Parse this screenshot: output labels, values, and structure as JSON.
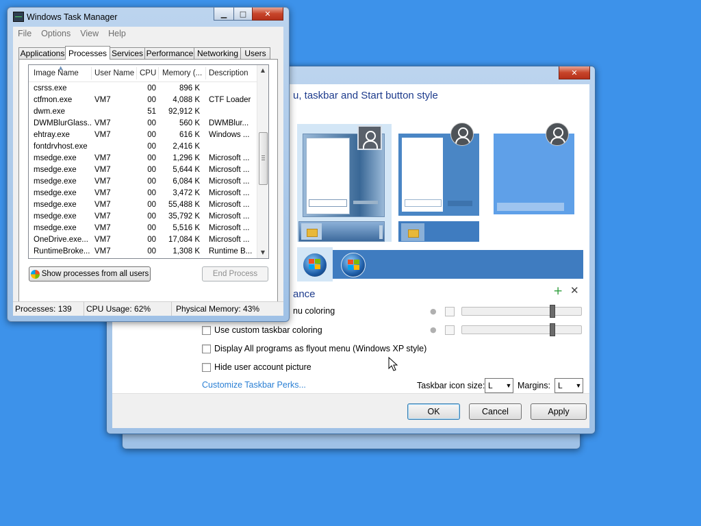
{
  "task_manager": {
    "title": "Windows Task Manager",
    "menu": [
      "File",
      "Options",
      "View",
      "Help"
    ],
    "tabs": [
      "Applications",
      "Processes",
      "Services",
      "Performance",
      "Networking",
      "Users"
    ],
    "active_tab": "Processes",
    "columns": [
      "Image Name",
      "User Name",
      "CPU",
      "Memory (...",
      "Description"
    ],
    "processes": [
      {
        "name": "csrss.exe",
        "user": "",
        "cpu": "00",
        "mem": "896 K",
        "desc": ""
      },
      {
        "name": "ctfmon.exe",
        "user": "VM7",
        "cpu": "00",
        "mem": "4,088 K",
        "desc": "CTF Loader"
      },
      {
        "name": "dwm.exe",
        "user": "",
        "cpu": "51",
        "mem": "92,912 K",
        "desc": ""
      },
      {
        "name": "DWMBlurGlass...",
        "user": "VM7",
        "cpu": "00",
        "mem": "560 K",
        "desc": "DWMBlur..."
      },
      {
        "name": "ehtray.exe",
        "user": "VM7",
        "cpu": "00",
        "mem": "616 K",
        "desc": "Windows ..."
      },
      {
        "name": "fontdrvhost.exe",
        "user": "",
        "cpu": "00",
        "mem": "2,416 K",
        "desc": ""
      },
      {
        "name": "msedge.exe",
        "user": "VM7",
        "cpu": "00",
        "mem": "1,296 K",
        "desc": "Microsoft ..."
      },
      {
        "name": "msedge.exe",
        "user": "VM7",
        "cpu": "00",
        "mem": "5,644 K",
        "desc": "Microsoft ..."
      },
      {
        "name": "msedge.exe",
        "user": "VM7",
        "cpu": "00",
        "mem": "6,084 K",
        "desc": "Microsoft ..."
      },
      {
        "name": "msedge.exe",
        "user": "VM7",
        "cpu": "00",
        "mem": "3,472 K",
        "desc": "Microsoft ..."
      },
      {
        "name": "msedge.exe",
        "user": "VM7",
        "cpu": "00",
        "mem": "55,488 K",
        "desc": "Microsoft ..."
      },
      {
        "name": "msedge.exe",
        "user": "VM7",
        "cpu": "00",
        "mem": "35,792 K",
        "desc": "Microsoft ..."
      },
      {
        "name": "msedge.exe",
        "user": "VM7",
        "cpu": "00",
        "mem": "5,516 K",
        "desc": "Microsoft ..."
      },
      {
        "name": "OneDrive.exe...",
        "user": "VM7",
        "cpu": "00",
        "mem": "17,084 K",
        "desc": "Microsoft ..."
      },
      {
        "name": "RuntimeBroke...",
        "user": "VM7",
        "cpu": "00",
        "mem": "1,308 K",
        "desc": "Runtime B..."
      }
    ],
    "show_all_label": "Show processes from all users",
    "end_process_label": "End Process",
    "status": {
      "processes": "Processes: 139",
      "cpu": "CPU Usage: 62%",
      "memory": "Physical Memory: 43%"
    }
  },
  "shell_settings": {
    "heading_style": "u, taskbar and Start button style",
    "heading_appearance": "ance",
    "options": {
      "menu_coloring": "nu coloring",
      "custom_taskbar_coloring": "Use custom taskbar coloring",
      "flyout_menu": "Display All programs as flyout menu (Windows XP style)",
      "hide_user_picture": "Hide user account picture"
    },
    "customize_link": "Customize Taskbar Perks...",
    "taskbar_icon_size_label": "Taskbar icon size:",
    "taskbar_icon_size_value": "L",
    "margins_label": "Margins:",
    "margins_value": "L",
    "buttons": {
      "ok": "OK",
      "cancel": "Cancel",
      "apply": "Apply"
    },
    "slider_levels": {
      "menu_coloring": 0.76,
      "taskbar_coloring": 0.76
    }
  },
  "colors": {
    "desktop": "#3d92ea",
    "heading": "#1d3b8c",
    "link": "#2a7fd4",
    "preview_blue": "#4a86c5",
    "taskbar_blue": "#3f7cc0"
  }
}
